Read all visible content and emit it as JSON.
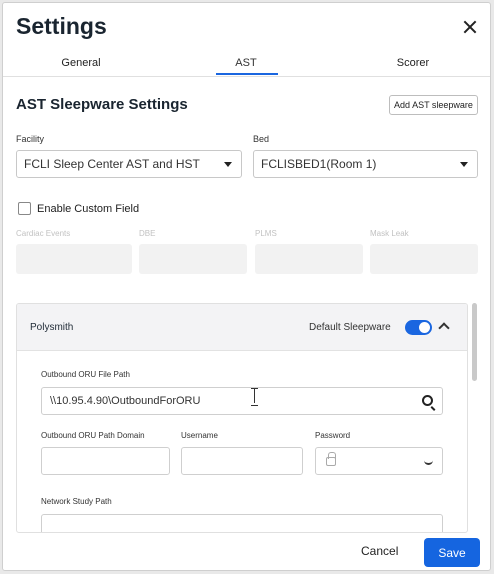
{
  "dialog": {
    "title": "Settings",
    "tabs": [
      "General",
      "AST",
      "Scorer"
    ],
    "active_tab": "AST",
    "section_title": "AST Sleepware Settings",
    "add_button": "Add AST sleepware"
  },
  "facility": {
    "label": "Facility",
    "value": "FCLI Sleep Center AST and HST"
  },
  "bed": {
    "label": "Bed",
    "value": "FCLISBED1(Room 1)"
  },
  "custom_field": {
    "checkbox_label": "Enable Custom Field",
    "checked": false,
    "fields": [
      "Cardiac Events",
      "DBE",
      "PLMS",
      "Mask Leak"
    ]
  },
  "panel": {
    "name": "Polysmith",
    "default_label": "Default Sleepware",
    "default_enabled": true,
    "outbound_path_label": "Outbound ORU File Path",
    "outbound_path_value": "\\\\10.95.4.90\\OutboundForORU",
    "domain_label": "Outbound ORU Path Domain",
    "username_label": "Username",
    "password_label": "Password",
    "network_label": "Network Study Path"
  },
  "footer": {
    "cancel": "Cancel",
    "save": "Save"
  },
  "colors": {
    "accent": "#1565e0",
    "disabled_bg": "#f2f2f2"
  }
}
